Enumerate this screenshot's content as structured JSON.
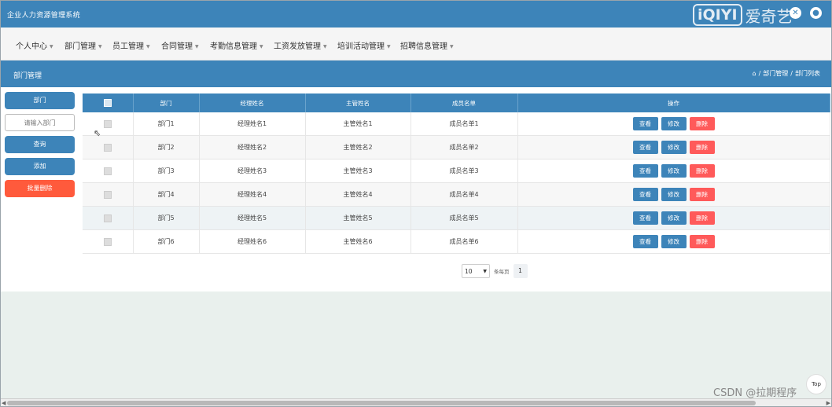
{
  "app": {
    "title": "企业人力资源管理系统"
  },
  "watermark": {
    "logo": "iQIYI",
    "text": "爱奇艺"
  },
  "nav": [
    {
      "label": "个人中心"
    },
    {
      "label": "部门管理"
    },
    {
      "label": "员工管理"
    },
    {
      "label": "合同管理"
    },
    {
      "label": "考勤信息管理"
    },
    {
      "label": "工资发放管理"
    },
    {
      "label": "培训活动管理"
    },
    {
      "label": "招聘信息管理"
    }
  ],
  "page": {
    "title": "部门管理"
  },
  "breadcrumb": {
    "home_icon": "home-icon",
    "sep": "/",
    "level1": "部门管理",
    "level2": "部门列表"
  },
  "sidebar": {
    "field_label": "部门",
    "input_placeholder": "请输入部门",
    "query_label": "查询",
    "add_label": "添加",
    "batch_delete_label": "批量删除"
  },
  "table": {
    "headers": [
      "部门",
      "经理姓名",
      "主管姓名",
      "成员名单",
      "操作"
    ],
    "rows": [
      [
        "部门1",
        "经理姓名1",
        "主管姓名1",
        "成员名单1"
      ],
      [
        "部门2",
        "经理姓名2",
        "主管姓名2",
        "成员名单2"
      ],
      [
        "部门3",
        "经理姓名3",
        "主管姓名3",
        "成员名单3"
      ],
      [
        "部门4",
        "经理姓名4",
        "主管姓名4",
        "成员名单4"
      ],
      [
        "部门5",
        "经理姓名5",
        "主管姓名5",
        "成员名单5"
      ],
      [
        "部门6",
        "经理姓名6",
        "主管姓名6",
        "成员名单6"
      ]
    ],
    "actions": {
      "view": "查看",
      "edit": "修改",
      "delete": "删除"
    }
  },
  "pager": {
    "page_size": "10",
    "per_page_text": "条每页",
    "current_page": "1"
  },
  "footer": {
    "top_label": "Top",
    "csdn": "CSDN @拉期程序"
  },
  "colors": {
    "primary": "#3d84b9",
    "danger": "#ff5a5a",
    "batch_delete": "#ff5a3c"
  }
}
